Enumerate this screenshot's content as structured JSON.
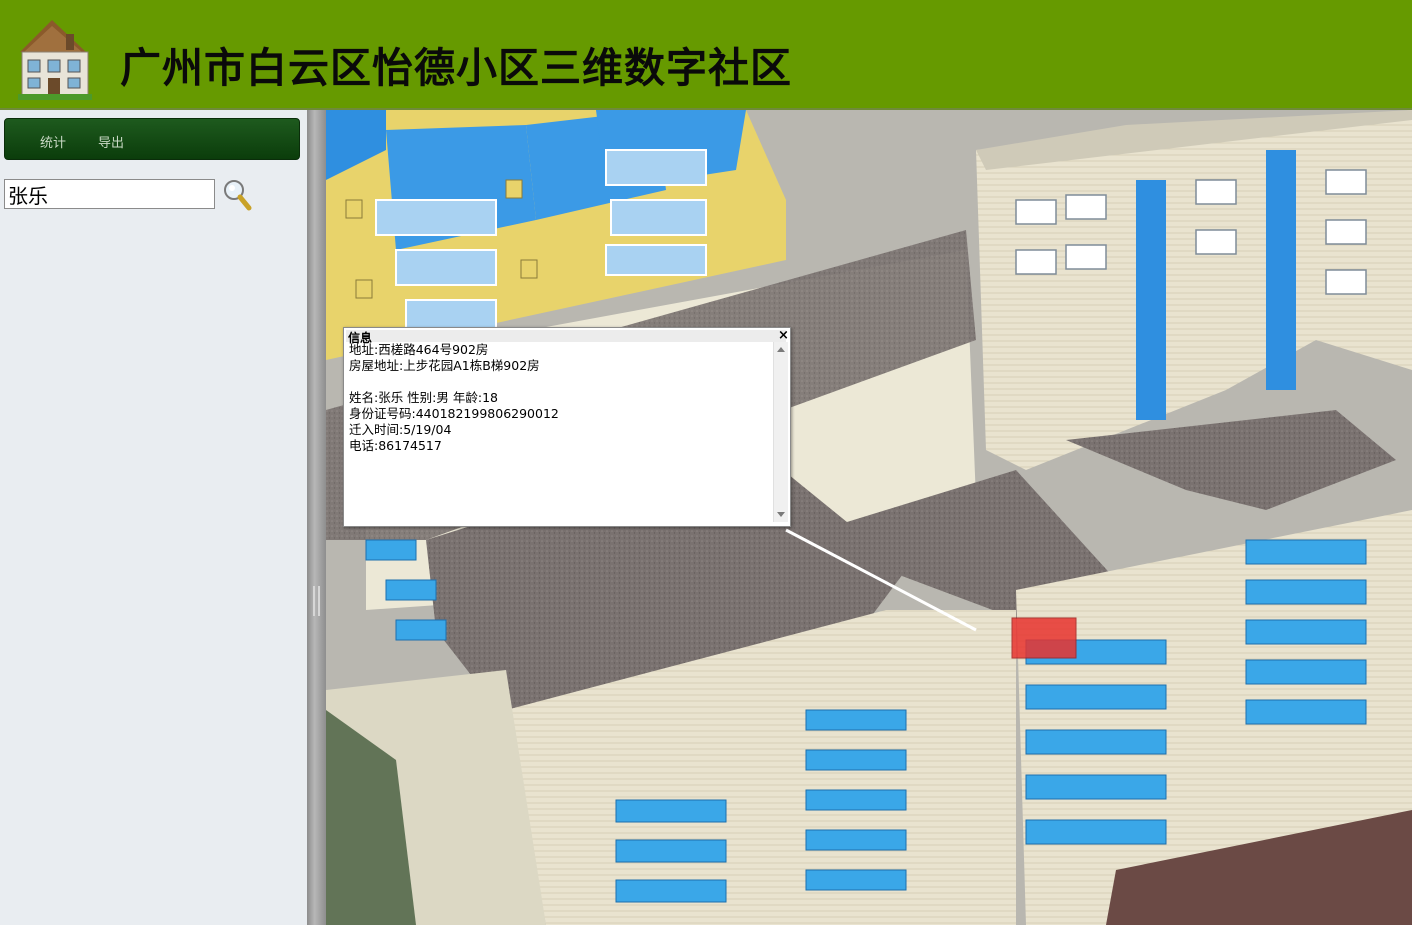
{
  "header": {
    "title": "广州市白云区怡德小区三维数字社区",
    "logo_icon": "house-icon"
  },
  "toolbar": {
    "stats_label": "统计",
    "export_label": "导出"
  },
  "search": {
    "value": "张乐",
    "button_icon": "magnifier-icon"
  },
  "popup": {
    "title": "信息",
    "close_glyph": "×",
    "lines": {
      "address": "地址:西槎路464号902房",
      "house_address": "房屋地址:上步花园A1栋B梯902房",
      "blank": "",
      "person": "姓名:张乐 性别:男 年龄:18",
      "id_number": "身份证号码:440182199806290012",
      "move_in": "迁入时间:5/19/04",
      "phone": "电话:86174517"
    }
  },
  "colors": {
    "header_bg": "#669a00",
    "toolbar_bg": "#0b3d0b",
    "highlight_unit": "#e8332f",
    "balcony_blue": "#3aa7e8",
    "facade_yellow": "#e8d36b"
  }
}
